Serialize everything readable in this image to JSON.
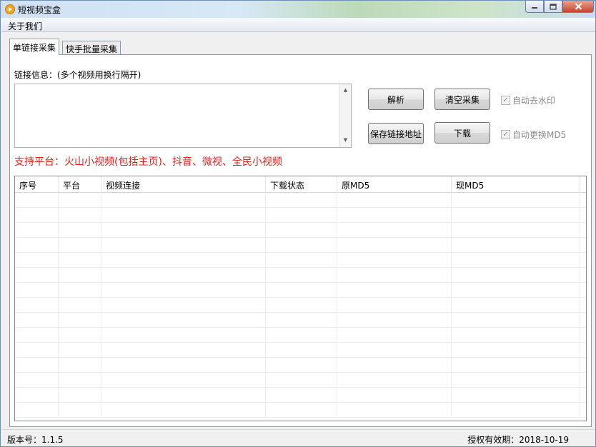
{
  "window": {
    "title": "短视频宝盒"
  },
  "menu": {
    "about": "关于我们"
  },
  "tabs": [
    {
      "label": "单链接采集",
      "active": true
    },
    {
      "label": "快手批量采集",
      "active": false
    }
  ],
  "link_input": {
    "label": "链接信息：(多个视频用换行隔开)",
    "value": ""
  },
  "buttons": {
    "parse": "解析",
    "clear": "清空采集",
    "save_links": "保存链接地址",
    "download": "下载"
  },
  "options": {
    "auto_watermark": {
      "label": "自动去水印",
      "checked": true
    },
    "auto_md5": {
      "label": "自动更换MD5",
      "checked": true
    }
  },
  "platforms_note": "支持平台：火山小视频(包括主页)、抖音、微视、全民小视频",
  "table": {
    "columns": [
      "序号",
      "平台",
      "视频连接",
      "下载状态",
      "原MD5",
      "现MD5"
    ],
    "rows": []
  },
  "status": {
    "version": "版本号：1.1.5",
    "license": "授权有效期：2018-10-19"
  },
  "colors": {
    "platform_note": "#e0201a",
    "close_button": "#c7442b"
  },
  "icons": {
    "app": "play-icon",
    "minimize": "minimize-icon",
    "maximize": "maximize-icon",
    "close": "close-icon",
    "scroll_up": "scroll-up-icon",
    "scroll_down": "scroll-down-icon",
    "check": "check-icon"
  }
}
